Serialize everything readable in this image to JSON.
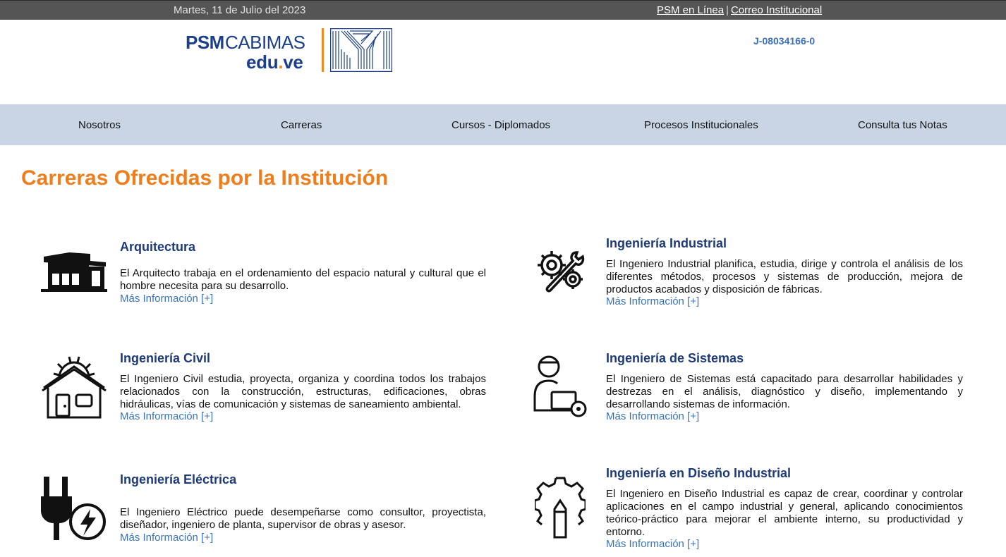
{
  "topbar": {
    "date": "Martes, 11 de Julio del 2023",
    "link_psm": "PSM en Línea",
    "separator": "|",
    "link_correo": "Correo Institucional"
  },
  "header": {
    "logo": {
      "psm": "PSM",
      "cabimas": "CABIMAS",
      "edu": "edu",
      "dot": ".",
      "ve": "ve"
    },
    "rif": "J-08034166-0"
  },
  "nav": {
    "items": [
      {
        "label": "Nosotros"
      },
      {
        "label": "Carreras"
      },
      {
        "label": "Cursos - Diplomados"
      },
      {
        "label": "Procesos Institucionales"
      },
      {
        "label": "Consulta tus Notas"
      }
    ]
  },
  "main": {
    "title": "Carreras Ofrecidas por la Institución",
    "more_label": "Más Información [+]",
    "careers": [
      {
        "title": "Arquitectura",
        "icon": "building-icon",
        "desc": "El Arquitecto trabaja en el ordenamiento del espacio natural y cultural que el hombre necesita para su desarrollo."
      },
      {
        "title": "Ingeniería Industrial",
        "icon": "gears-wrench-icon",
        "desc": "El Ingeniero Industrial planifica, estudia, dirige y controla el análisis de los diferentes métodos, procesos y sistemas de producción, mejora de productos acabados y disposición de fábricas."
      },
      {
        "title": "Ingeniería Civil",
        "icon": "house-gear-icon",
        "desc": "El Ingeniero Civil estudia, proyecta, organiza y coordina todos los trabajos relacionados con la construcción, estructuras, edificaciones, obras hidráulicas, vías de comunicación y sistemas de saneamiento ambiental."
      },
      {
        "title": "Ingeniería de Sistemas",
        "icon": "person-computer-icon",
        "desc": "El Ingeniero de Sistemas está capacitado para desarrollar habilidades y destrezas en el análisis, diagnóstico y diseño, implementando y desarrollando sistemas de información."
      },
      {
        "title": "Ingeniería Eléctrica",
        "icon": "plug-bolt-icon",
        "desc": "El Ingeniero Eléctrico puede desempeñarse como consultor, proyectista, diseñador, ingeniero de planta, supervisor de obras y asesor."
      },
      {
        "title": "Ingeniería en Diseño Industrial",
        "icon": "gear-pencil-icon",
        "desc": "El Ingeniero en Diseño Industrial es capaz de crear, coordinar y controlar aplicaciones en el campo industrial y general, aplicando conocimientos teórico-práctico para mejorar el ambiente interno, su productividad y entorno."
      }
    ]
  }
}
